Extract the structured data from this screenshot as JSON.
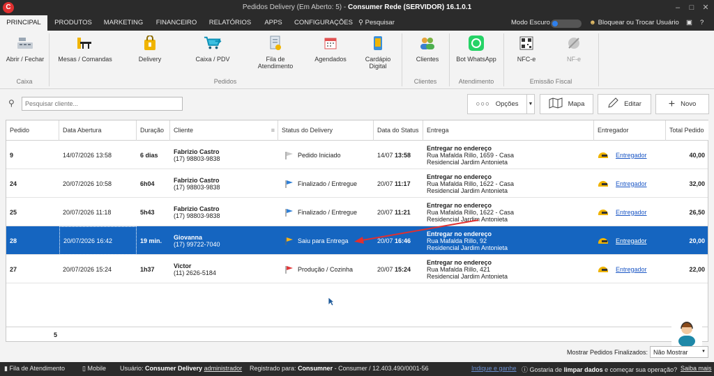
{
  "window": {
    "title_prefix": "Pedidos Delivery (Em Aberto: 5)",
    "title_sep": " - ",
    "title_suffix": "Consumer Rede (SERVIDOR) 16.1.0.1",
    "logo_letter": "C"
  },
  "menu": {
    "tabs": [
      "PRINCIPAL",
      "PRODUTOS",
      "MARKETING",
      "FINANCEIRO",
      "RELATÓRIOS",
      "APPS",
      "CONFIGURAÇÕES"
    ],
    "search_label": "Pesquisar",
    "dark_mode_label": "Modo Escuro",
    "lock_user_label": "Bloquear ou Trocar Usuário"
  },
  "ribbon": {
    "buttons": {
      "abrir_fechar": "Abrir / Fechar",
      "mesas": "Mesas / Comandas",
      "delivery": "Delivery",
      "caixa_pdv": "Caixa / PDV",
      "fila_1": "Fila de",
      "fila_2": "Atendimento",
      "agendados": "Agendados",
      "cardapio_1": "Cardápio",
      "cardapio_2": "Digital",
      "clientes": "Clientes",
      "bot_whatsapp": "Bot WhatsApp",
      "nfce": "NFC-e",
      "nfe": "NF-e"
    },
    "groups": {
      "caixa": "Caixa",
      "pedidos": "Pedidos",
      "clientes": "Clientes",
      "atendimento": "Atendimento",
      "emissao": "Emissão Fiscal"
    }
  },
  "toolbar": {
    "search_placeholder": "Pesquisar cliente...",
    "opcoes": "Opções",
    "mapa": "Mapa",
    "editar": "Editar",
    "novo": "Novo"
  },
  "grid": {
    "columns": [
      "Pedido",
      "Data Abertura",
      "Duração",
      "Cliente",
      "Status do Delivery",
      "Data do Status",
      "Entrega",
      "Entregador",
      "Total Pedido"
    ],
    "rows": [
      {
        "pedido": "9",
        "abertura": "14/07/2026 13:58",
        "duracao": "6 dias",
        "cliente": "Fabrizio Castro",
        "fone": "(17) 98803-9838",
        "status": "Pedido Iniciado",
        "flag_color": "#c8c8c8",
        "status_date": "14/07",
        "status_time": "13:58",
        "entrega_title": "Entregar no endereço",
        "entrega_rua": "Rua Mafalda Rillo, 1659 - Casa",
        "entrega_bairro": "Residencial Jardim Antonieta",
        "entregador": "Entregador",
        "total": "40,00"
      },
      {
        "pedido": "24",
        "abertura": "20/07/2026 10:58",
        "duracao": "6h04",
        "cliente": "Fabrizio Castro",
        "fone": "(17) 98803-9838",
        "status": "Finalizado / Entregue",
        "flag_color": "#2f7fd6",
        "status_date": "20/07",
        "status_time": "11:17",
        "entrega_title": "Entregar no endereço",
        "entrega_rua": "Rua Mafalda Rillo, 1622 - Casa",
        "entrega_bairro": "Residencial Jardim Antonieta",
        "entregador": "Entregador",
        "total": "32,00"
      },
      {
        "pedido": "25",
        "abertura": "20/07/2026 11:18",
        "duracao": "5h43",
        "cliente": "Fabrizio Castro",
        "fone": "(17) 98803-9838",
        "status": "Finalizado / Entregue",
        "flag_color": "#2f7fd6",
        "status_date": "20/07",
        "status_time": "11:21",
        "entrega_title": "Entregar no endereço",
        "entrega_rua": "Rua Mafalda Rillo, 1622 - Casa",
        "entrega_bairro": "Residencial Jardim Antonieta",
        "entregador": "Entregador",
        "total": "26,50"
      },
      {
        "pedido": "28",
        "abertura": "20/07/2026 16:42",
        "duracao": "19 min.",
        "cliente": "Giovanna",
        "fone": "(17) 99722-7040",
        "status": "Saiu para Entrega",
        "flag_color": "#f2b21b",
        "status_date": "20/07",
        "status_time": "16:46",
        "entrega_title": "Entregar no endereço",
        "entrega_rua": "Rua Mafalda Rillo, 92",
        "entrega_bairro": "Residencial Jardim Antonieta",
        "entregador": "Entregador",
        "total": "20,00"
      },
      {
        "pedido": "27",
        "abertura": "20/07/2026 15:24",
        "duracao": "1h37",
        "cliente": "Victor",
        "fone": "(11) 2626-5184",
        "status": "Produção / Cozinha",
        "flag_color": "#e0383a",
        "status_date": "20/07",
        "status_time": "15:24",
        "entrega_title": "Entregar no endereço",
        "entrega_rua": "Rua Mafalda Rillo, 421",
        "entrega_bairro": "Residencial Jardim Antonieta",
        "entregador": "Entregador",
        "total": "22,00"
      }
    ],
    "count": "5",
    "selected_row": 3
  },
  "finalizados": {
    "label": "Mostrar Pedidos Finalizados:",
    "value": "Não Mostrar"
  },
  "statusbar": {
    "fila": "Fila de Atendimento",
    "mobile": "Mobile",
    "usuario_label": "Usuário:",
    "usuario_nome": "Consumer Delivery",
    "usuario_perfil": "administrador",
    "registrado_label": "Registrado para:",
    "registrado_nome": "Consumner",
    "registrado_info": "- Consumer / 12.403.490/0001-56",
    "indique": "Indique e ganhe",
    "gostaria": "Gostaria de",
    "limpar": "limpar dados",
    "comecar": "e começar sua operação?",
    "saiba": "Saiba mais"
  },
  "colors": {
    "titlebar": "#2b2b2b",
    "selection": "#1565c0",
    "link": "#1a56c5"
  }
}
